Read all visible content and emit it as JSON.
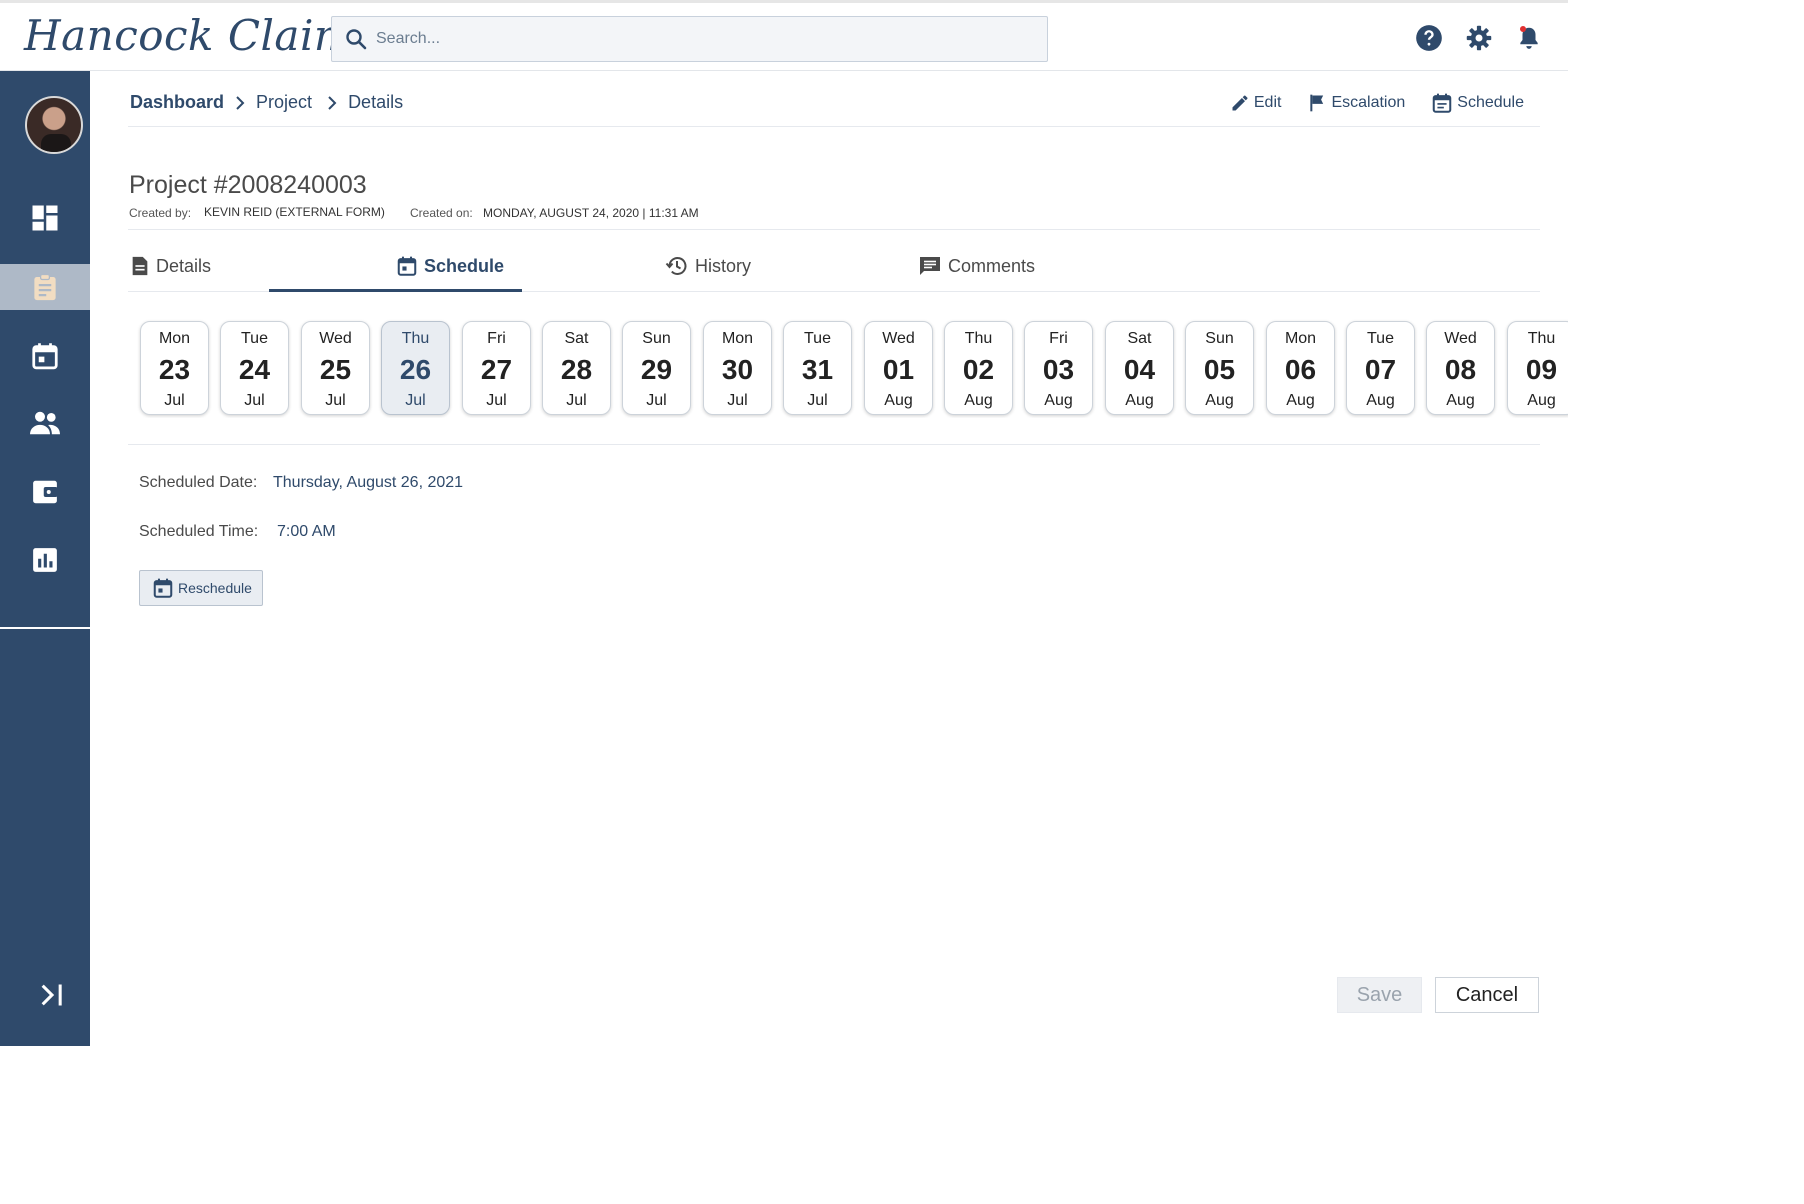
{
  "app": {
    "logo_text": "Hancock Claims",
    "brand_color": "#2f4a6b"
  },
  "search": {
    "placeholder": "Search...",
    "value": ""
  },
  "header_icons": [
    "help-icon",
    "gear-icon",
    "bell-icon"
  ],
  "sidebar": {
    "items": [
      {
        "name": "dashboard-icon",
        "active": false
      },
      {
        "name": "clipboard-icon",
        "active": true
      },
      {
        "name": "calendar-icon",
        "active": false
      },
      {
        "name": "people-icon",
        "active": false
      },
      {
        "name": "wallet-icon",
        "active": false
      },
      {
        "name": "bar-chart-icon",
        "active": false
      }
    ]
  },
  "breadcrumb": [
    "Dashboard",
    "Project",
    "Details"
  ],
  "actions": {
    "edit": "Edit",
    "escalation": "Escalation",
    "schedule": "Schedule"
  },
  "project": {
    "title": "Project #2008240003",
    "created_by_label": "Created by:",
    "created_by": "KEVIN REID (EXTERNAL FORM)",
    "created_on_label": "Created on:",
    "created_on": "MONDAY, AUGUST 24, 2020 | 11:31 AM"
  },
  "tabs": [
    {
      "label": "Details",
      "active": false
    },
    {
      "label": "Schedule",
      "active": true
    },
    {
      "label": "History",
      "active": false
    },
    {
      "label": "Comments",
      "active": false
    }
  ],
  "days": [
    {
      "dow": "Mon",
      "num": "23",
      "mon": "Jul"
    },
    {
      "dow": "Tue",
      "num": "24",
      "mon": "Jul"
    },
    {
      "dow": "Wed",
      "num": "25",
      "mon": "Jul"
    },
    {
      "dow": "Thu",
      "num": "26",
      "mon": "Jul",
      "selected": true
    },
    {
      "dow": "Fri",
      "num": "27",
      "mon": "Jul"
    },
    {
      "dow": "Sat",
      "num": "28",
      "mon": "Jul"
    },
    {
      "dow": "Sun",
      "num": "29",
      "mon": "Jul"
    },
    {
      "dow": "Mon",
      "num": "30",
      "mon": "Jul"
    },
    {
      "dow": "Tue",
      "num": "31",
      "mon": "Jul"
    },
    {
      "dow": "Wed",
      "num": "01",
      "mon": "Aug"
    },
    {
      "dow": "Thu",
      "num": "02",
      "mon": "Aug"
    },
    {
      "dow": "Fri",
      "num": "03",
      "mon": "Aug"
    },
    {
      "dow": "Sat",
      "num": "04",
      "mon": "Aug"
    },
    {
      "dow": "Sun",
      "num": "05",
      "mon": "Aug"
    },
    {
      "dow": "Mon",
      "num": "06",
      "mon": "Aug"
    },
    {
      "dow": "Tue",
      "num": "07",
      "mon": "Aug"
    },
    {
      "dow": "Wed",
      "num": "08",
      "mon": "Aug"
    },
    {
      "dow": "Thu",
      "num": "09",
      "mon": "Aug"
    }
  ],
  "schedule": {
    "date_label": "Scheduled Date:",
    "date_value": "Thursday, August 26, 2021",
    "time_label": "Scheduled Time:",
    "time_value": "7:00 AM",
    "reschedule_label": "Reschedule"
  },
  "footer": {
    "save_label": "Save",
    "cancel_label": "Cancel"
  }
}
